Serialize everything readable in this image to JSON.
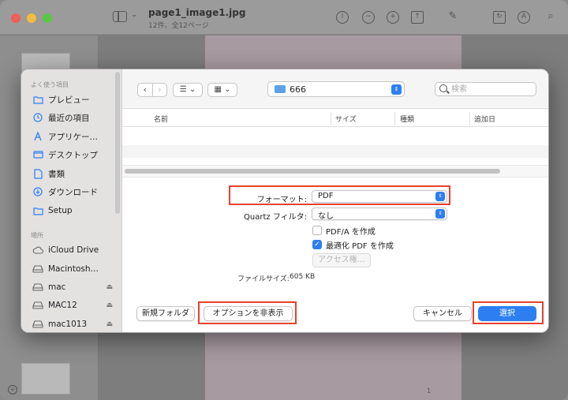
{
  "window": {
    "title": "page1_image1.jpg",
    "subtitle": "12件、全12ページ",
    "page_number": "1"
  },
  "sidebar": {
    "favorites_header": "よく使う項目",
    "favorites": [
      {
        "label": "プレビュー",
        "icon": "folder-icon"
      },
      {
        "label": "最近の項目",
        "icon": "clock-icon"
      },
      {
        "label": "アプリケー…",
        "icon": "apps-icon"
      },
      {
        "label": "デスクトップ",
        "icon": "desktop-icon"
      },
      {
        "label": "書類",
        "icon": "document-icon"
      },
      {
        "label": "ダウンロード",
        "icon": "download-icon"
      },
      {
        "label": "Setup",
        "icon": "folder-icon"
      }
    ],
    "locations_header": "場所",
    "locations": [
      {
        "label": "iCloud Drive",
        "icon": "cloud-icon",
        "eject": false
      },
      {
        "label": "Macintosh…",
        "icon": "disk-icon",
        "eject": false
      },
      {
        "label": "mac",
        "icon": "disk-icon",
        "eject": true
      },
      {
        "label": "MAC12",
        "icon": "disk-icon",
        "eject": true
      },
      {
        "label": "mac1013",
        "icon": "disk-icon",
        "eject": true
      }
    ]
  },
  "toolbar": {
    "location": "666",
    "search_placeholder": "検索"
  },
  "columns": {
    "name": "名前",
    "size": "サイズ",
    "kind": "種類",
    "date_added": "追加日"
  },
  "options": {
    "format_label": "フォーマット:",
    "format_value": "PDF",
    "quartz_label": "Quartz フィルタ:",
    "quartz_value": "なし",
    "pdfa_label": "PDF/A を作成",
    "pdfa_checked": false,
    "optimize_label": "最適化 PDF を作成",
    "optimize_checked": true,
    "access_button": "アクセス権…",
    "file_size_label": "ファイルサイズ:",
    "file_size_value": "605 KB"
  },
  "footer": {
    "new_folder": "新規フォルダ",
    "hide_options": "オプションを非表示",
    "cancel": "キャンセル",
    "select": "選択"
  },
  "colors": {
    "accent": "#2d7ff1",
    "highlight": "#e8412f"
  }
}
